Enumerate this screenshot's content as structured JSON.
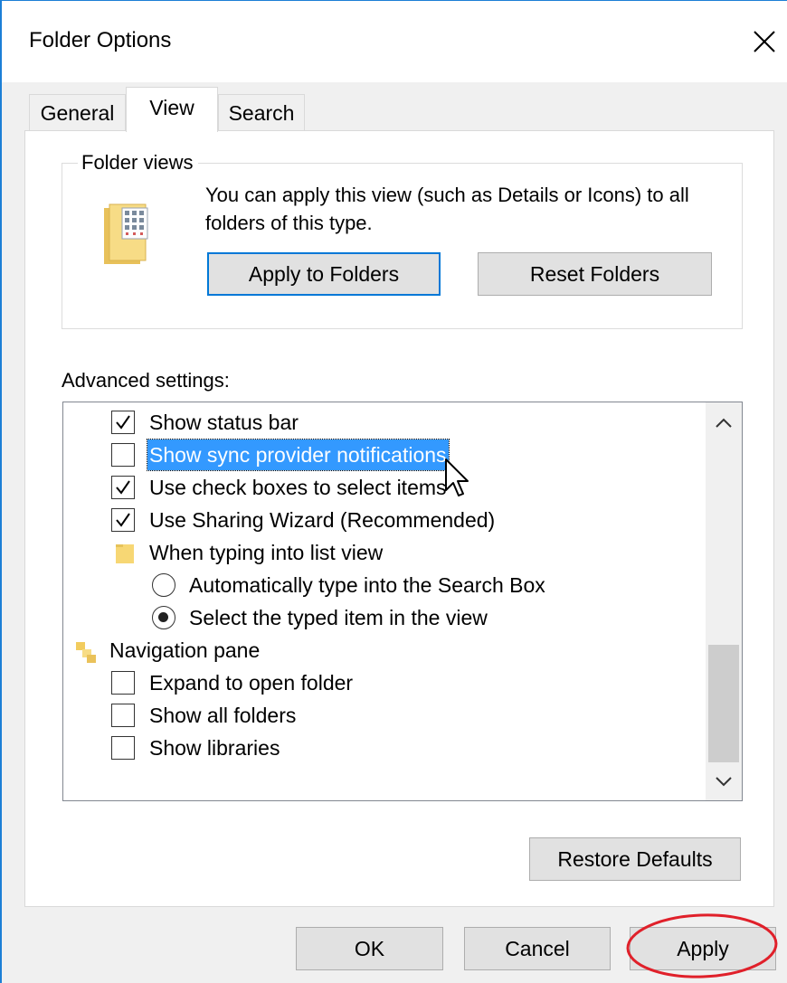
{
  "window": {
    "title": "Folder Options"
  },
  "tabs": [
    {
      "label": "General",
      "active": false
    },
    {
      "label": "View",
      "active": true
    },
    {
      "label": "Search",
      "active": false
    }
  ],
  "folder_views": {
    "title": "Folder views",
    "description": "You can apply this view (such as Details or Icons) to all folders of this type.",
    "apply_button": "Apply to Folders",
    "reset_button": "Reset Folders"
  },
  "advanced": {
    "label": "Advanced settings:",
    "items": [
      {
        "type": "checkbox",
        "label": "Show status bar",
        "checked": true
      },
      {
        "type": "checkbox",
        "label": "Show sync provider notifications",
        "checked": false,
        "selected": true
      },
      {
        "type": "checkbox",
        "label": "Use check boxes to select items",
        "checked": true
      },
      {
        "type": "checkbox",
        "label": "Use Sharing Wizard (Recommended)",
        "checked": true
      },
      {
        "type": "group",
        "label": "When typing into list view",
        "icon": "folder-icon"
      },
      {
        "type": "radio",
        "label": "Automatically type into the Search Box",
        "checked": false
      },
      {
        "type": "radio",
        "label": "Select the typed item in the view",
        "checked": true
      },
      {
        "type": "group",
        "label": "Navigation pane",
        "icon": "navigation-pane-icon"
      },
      {
        "type": "checkbox",
        "label": "Expand to open folder",
        "checked": false
      },
      {
        "type": "checkbox",
        "label": "Show all folders",
        "checked": false
      },
      {
        "type": "checkbox",
        "label": "Show libraries",
        "checked": false
      }
    ]
  },
  "buttons": {
    "restore_defaults": "Restore Defaults",
    "ok": "OK",
    "cancel": "Cancel",
    "apply": "Apply"
  },
  "colors": {
    "accent": "#0078d7",
    "selection": "#3399ff",
    "annotation": "#e0202a"
  }
}
